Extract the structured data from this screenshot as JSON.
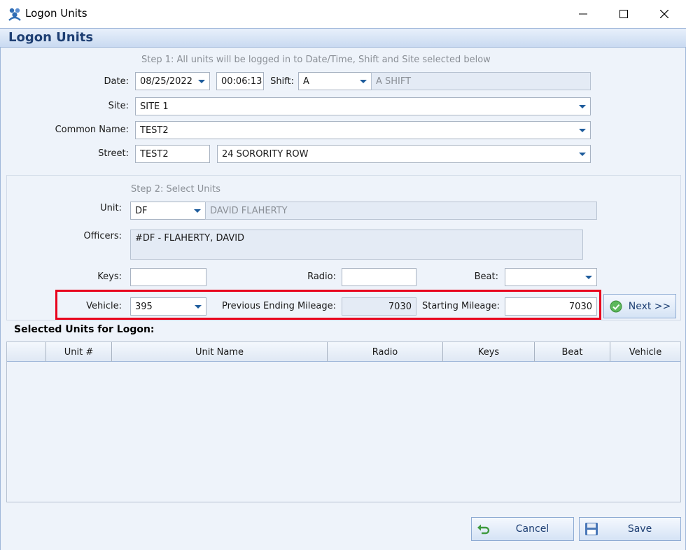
{
  "window": {
    "title": "Logon Units",
    "header_title": "Logon Units",
    "controls": {
      "minimize": "minimize",
      "maximize": "maximize",
      "close": "close"
    }
  },
  "step1": {
    "label": "Step 1: All units will be logged in to Date/Time, Shift and Site selected below",
    "date_label": "Date:",
    "date_value": "08/25/2022",
    "time_value": "00:06:13",
    "shift_label": "Shift:",
    "shift_value": "A",
    "shift_name": "A SHIFT",
    "site_label": "Site:",
    "site_value": "SITE 1",
    "common_name_label": "Common Name:",
    "common_name_value": "TEST2",
    "street_label": "Street:",
    "street_number": "TEST2",
    "street_value": "24 SORORITY ROW"
  },
  "step2": {
    "label": "Step 2: Select Units",
    "unit_label": "Unit:",
    "unit_value": "DF",
    "unit_name": "DAVID FLAHERTY",
    "officers_label": "Officers:",
    "officers_value": "#DF - FLAHERTY, DAVID",
    "keys_label": "Keys:",
    "keys_value": "",
    "radio_label": "Radio:",
    "radio_value": "",
    "beat_label": "Beat:",
    "beat_value": "",
    "vehicle_label": "Vehicle:",
    "vehicle_value": "395",
    "prev_mileage_label": "Previous Ending Mileage:",
    "prev_mileage_value": "7030",
    "start_mileage_label": "Starting Mileage:",
    "start_mileage_value": "7030",
    "next_label": "Next >>"
  },
  "selected_units": {
    "title": "Selected Units for Logon:",
    "columns": [
      "",
      "Unit #",
      "Unit Name",
      "Radio",
      "Keys",
      "Beat",
      "Vehicle"
    ],
    "rows": []
  },
  "footer": {
    "cancel_label": "Cancel",
    "save_label": "Save"
  },
  "colors": {
    "header_text": "#1e3f73",
    "highlight_border": "#e8001c",
    "accent_blue": "#1e5c9c"
  }
}
